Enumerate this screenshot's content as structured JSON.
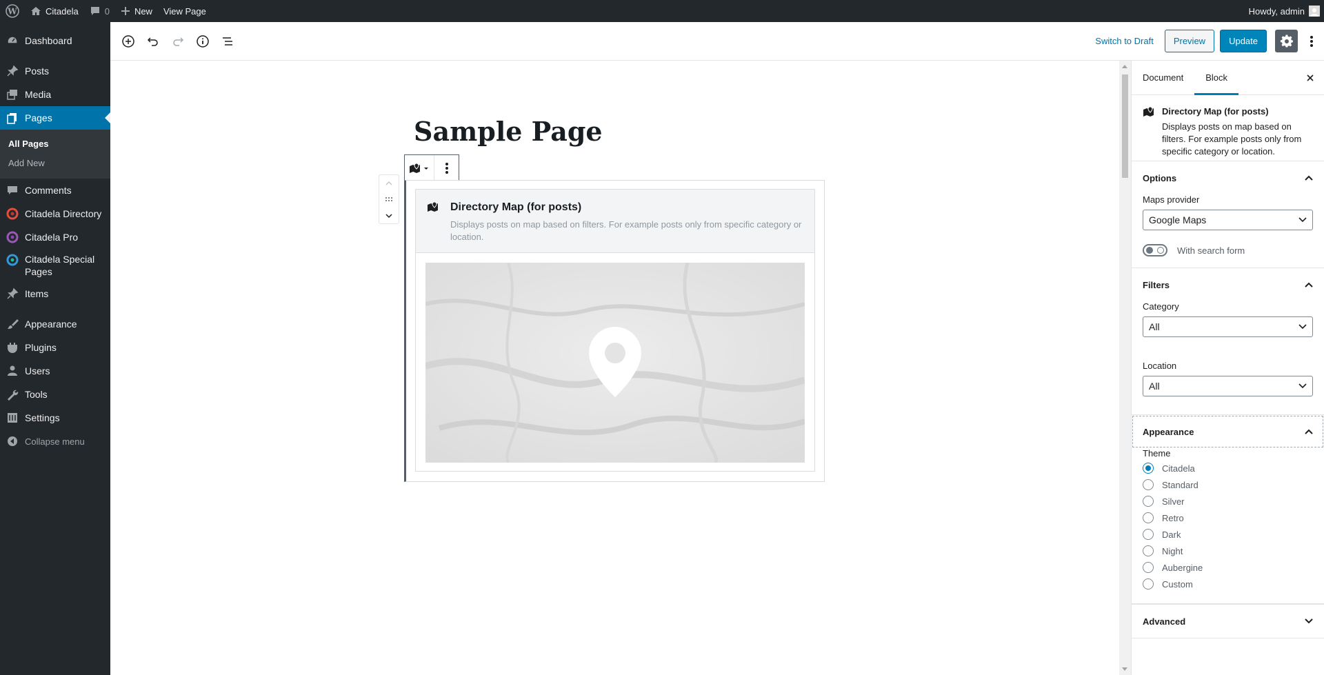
{
  "adminbar": {
    "site_name": "Citadela",
    "comments_count": "0",
    "new_label": "New",
    "view_page_label": "View Page",
    "greeting": "Howdy, admin"
  },
  "sidebar": {
    "items": [
      {
        "label": "Dashboard",
        "icon": "dashboard-icon"
      },
      {
        "label": "Posts",
        "icon": "pin-icon"
      },
      {
        "label": "Media",
        "icon": "media-icon"
      },
      {
        "label": "Pages",
        "icon": "pages-icon"
      },
      {
        "label": "Comments",
        "icon": "comments-icon"
      },
      {
        "label": "Citadela Directory",
        "icon": "citadela-icon"
      },
      {
        "label": "Citadela Pro",
        "icon": "citadela-icon"
      },
      {
        "label": "Citadela Special Pages",
        "icon": "citadela-icon"
      },
      {
        "label": "Items",
        "icon": "pin-icon"
      },
      {
        "label": "Appearance",
        "icon": "brush-icon"
      },
      {
        "label": "Plugins",
        "icon": "plugin-icon"
      },
      {
        "label": "Users",
        "icon": "users-icon"
      },
      {
        "label": "Tools",
        "icon": "wrench-icon"
      },
      {
        "label": "Settings",
        "icon": "settings-icon"
      }
    ],
    "submenu": [
      "All Pages",
      "Add New"
    ],
    "collapse_label": "Collapse menu",
    "accent": "#0073aa"
  },
  "header": {
    "switch_draft": "Switch to Draft",
    "preview": "Preview",
    "update": "Update"
  },
  "editor": {
    "title": "Sample Page",
    "block": {
      "title": "Directory Map (for posts)",
      "description": "Displays posts on map based on filters. For example posts only from specific category or location."
    }
  },
  "inspector": {
    "tabs": [
      "Document",
      "Block"
    ],
    "block_title": "Directory Map (for posts)",
    "block_desc": "Displays posts on map based on filters. For example posts only from specific category or location.",
    "options": {
      "title": "Options",
      "provider_label": "Maps provider",
      "provider_value": "Google Maps",
      "search_toggle": "With search form"
    },
    "filters": {
      "title": "Filters",
      "category_label": "Category",
      "category_value": "All",
      "location_label": "Location",
      "location_value": "All"
    },
    "appearance": {
      "title": "Appearance",
      "theme_label": "Theme",
      "themes": [
        "Citadela",
        "Standard",
        "Silver",
        "Retro",
        "Dark",
        "Night",
        "Aubergine",
        "Custom"
      ],
      "selected": "Citadela"
    },
    "advanced": {
      "title": "Advanced"
    }
  }
}
